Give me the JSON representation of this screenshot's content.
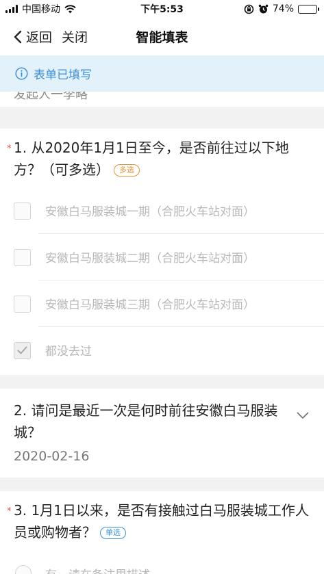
{
  "status_bar": {
    "carrier": "中国移动",
    "time": "下午5:53",
    "battery_percent": "74%",
    "battery_level": 0.74
  },
  "nav": {
    "back_label": "返回",
    "close_label": "关闭",
    "title": "智能填表"
  },
  "banner": {
    "text": "表单已填写"
  },
  "previous_answer": {
    "text": "发起人一李略"
  },
  "questions": [
    {
      "required_mark": "*",
      "text": "1. 从2020年1月1日至今，是否前往过以下地方？（可多选）",
      "tag": "多选",
      "options": [
        {
          "label": "安徽白马服装城一期（合肥火车站对面）",
          "checked": false
        },
        {
          "label": "安徽白马服装城二期（合肥火车站对面）",
          "checked": false
        },
        {
          "label": "安徽白马服装城三期（合肥火车站对面）",
          "checked": false
        },
        {
          "label": "都没去过",
          "checked": true
        }
      ]
    },
    {
      "text": "2. 请问是最近一次是何时前往安徽白马服装城？",
      "answer": "2020-02-16"
    },
    {
      "required_mark": "*",
      "text": "3. 1月1日以来，是否有接触过白马服装城工作人员或购物者？",
      "tag": "单选",
      "options": [
        {
          "label": "有，请在备注里描述"
        }
      ]
    }
  ],
  "colors": {
    "accent": "#3b8fd9",
    "banner_bg": "#e3f1fb",
    "required": "#e5533d",
    "multi_tag": "#e0953a",
    "page_bg": "#f2f2f2"
  }
}
